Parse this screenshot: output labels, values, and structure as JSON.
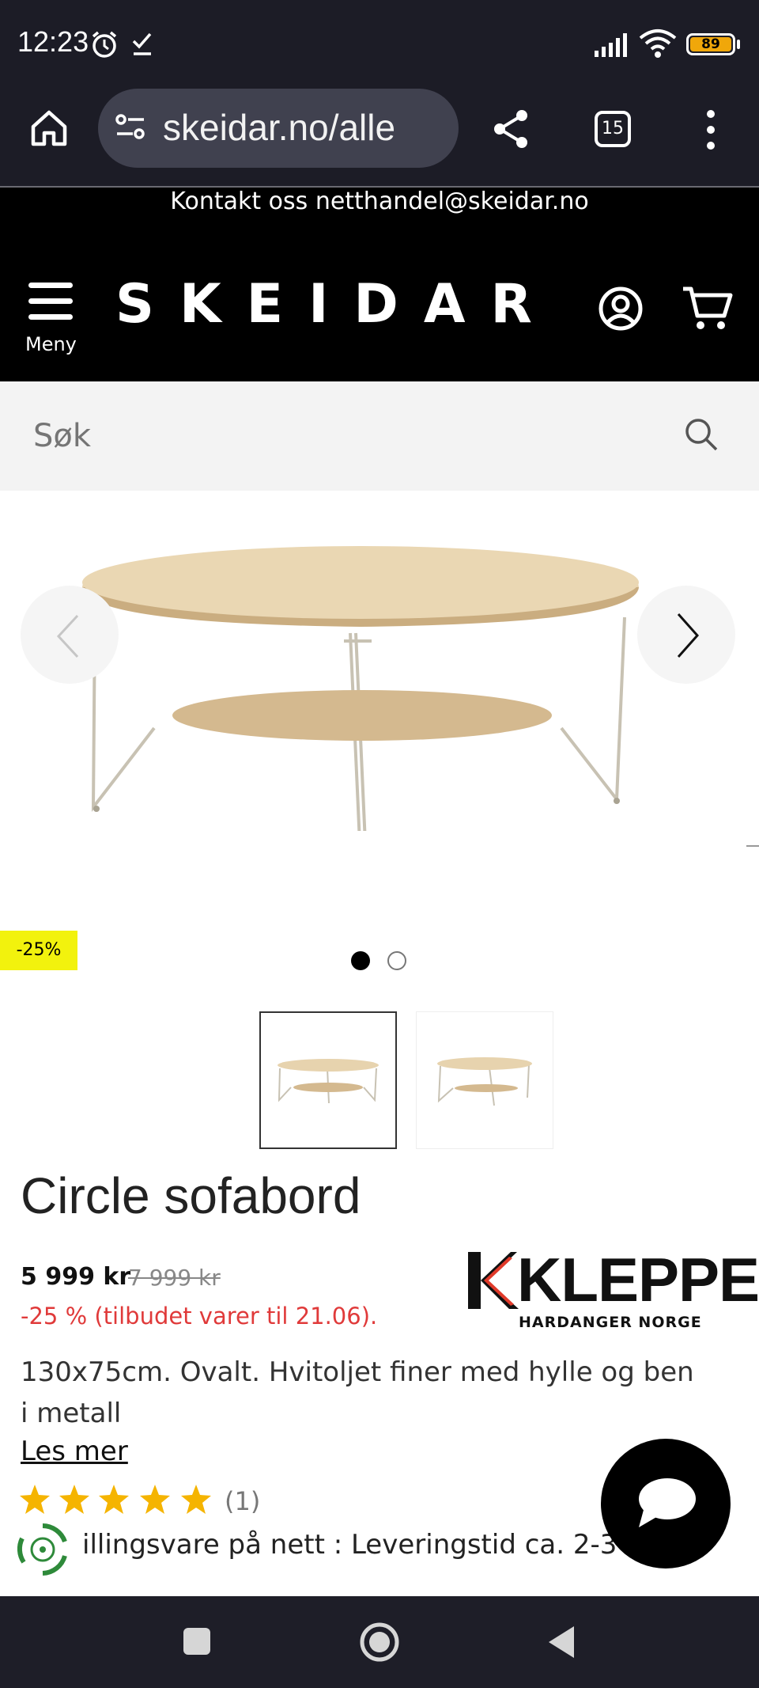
{
  "status_bar": {
    "time": "12:23",
    "battery": "89"
  },
  "browser": {
    "url": "skeidar.no/alle",
    "tab_count": "15"
  },
  "site": {
    "contact": "Kontakt oss netthandel@skeidar.no",
    "logo": "SKEIDAR",
    "menu_label": "Meny"
  },
  "search": {
    "placeholder": "Søk"
  },
  "carousel": {
    "discount_badge": "-25%",
    "active_index": 0,
    "total": 2
  },
  "product": {
    "title": "Circle sofabord",
    "price": "5 999 kr",
    "old_price": "7 999 kr",
    "offer_text": "-25 % (tilbudet varer til 21.06).",
    "description": "130x75cm. Ovalt. Hvitoljet finer med hylle og ben i metall",
    "read_more": "Les mer",
    "rating": 5,
    "review_count": "(1)",
    "delivery_text": "illingsvare på nett : Leveringstid ca. 2-3",
    "brand": {
      "name": "KLEPPE",
      "subtitle": "HARDANGER NORGE"
    }
  },
  "colors": {
    "badge": "#f2f20d",
    "offer": "#e03a3a",
    "star": "#f5b400",
    "header": "#000000"
  },
  "icons": [
    "home-icon",
    "site-settings-icon",
    "share-icon",
    "tabs-icon",
    "more-icon",
    "menu-icon",
    "account-icon",
    "cart-icon",
    "search-icon",
    "chevron-left-icon",
    "chevron-right-icon",
    "star-icon",
    "recycle-icon",
    "chat-icon"
  ]
}
